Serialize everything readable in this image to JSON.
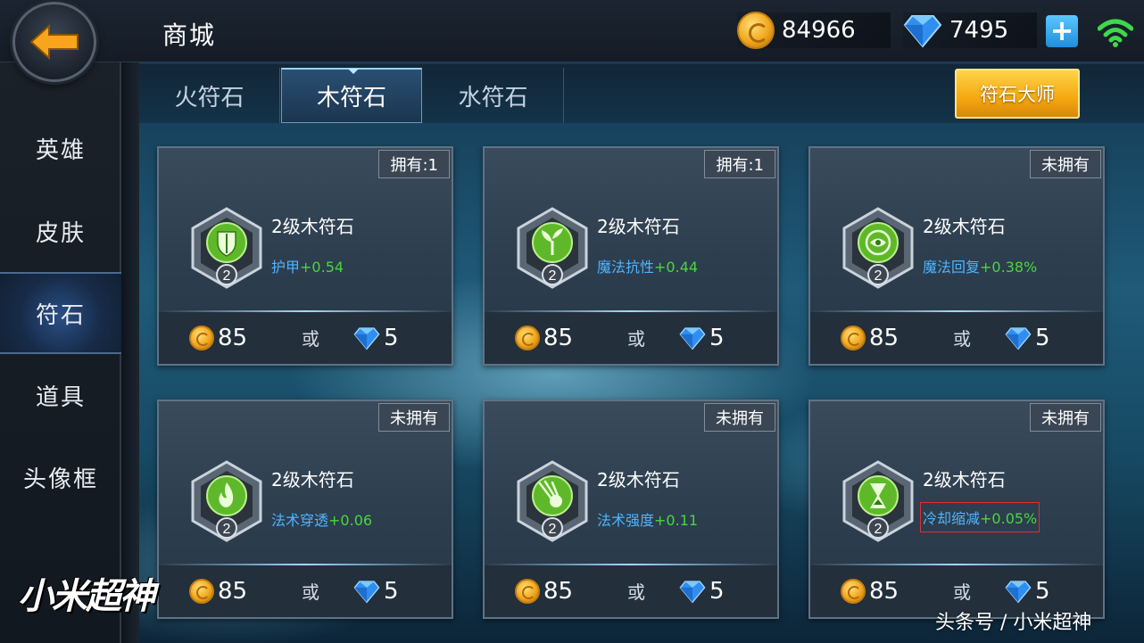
{
  "header": {
    "title": "商城",
    "gold": "84966",
    "gems": "7495"
  },
  "sidebar": {
    "items": [
      {
        "label": "英雄"
      },
      {
        "label": "皮肤"
      },
      {
        "label": "符石"
      },
      {
        "label": "道具"
      },
      {
        "label": "头像框"
      }
    ],
    "active": "符石"
  },
  "tabs": [
    {
      "label": "火符石"
    },
    {
      "label": "木符石"
    },
    {
      "label": "水符石"
    }
  ],
  "active_tab": "木符石",
  "master_button": "符石大师",
  "cards": [
    {
      "badge": "拥有:1",
      "level": "2",
      "name": "2级木符石",
      "stat_name": "护甲",
      "stat_value": "+0.54",
      "gold_price": "85",
      "or": "或",
      "gem_price": "5",
      "icon": "shield-icon"
    },
    {
      "badge": "拥有:1",
      "level": "2",
      "name": "2级木符石",
      "stat_name": "魔法抗性",
      "stat_value": "+0.44",
      "gold_price": "85",
      "or": "或",
      "gem_price": "5",
      "icon": "sprout-icon"
    },
    {
      "badge": "未拥有",
      "level": "2",
      "name": "2级木符石",
      "stat_name": "魔法回复",
      "stat_value": "+0.38%",
      "gold_price": "85",
      "or": "或",
      "gem_price": "5",
      "icon": "swirl-icon"
    },
    {
      "badge": "未拥有",
      "level": "2",
      "name": "2级木符石",
      "stat_name": "法术穿透",
      "stat_value": "+0.06",
      "gold_price": "85",
      "or": "或",
      "gem_price": "5",
      "icon": "flame-icon"
    },
    {
      "badge": "未拥有",
      "level": "2",
      "name": "2级木符石",
      "stat_name": "法术强度",
      "stat_value": "+0.11",
      "gold_price": "85",
      "or": "或",
      "gem_price": "5",
      "icon": "comet-icon"
    },
    {
      "badge": "未拥有",
      "level": "2",
      "name": "2级木符石",
      "stat_name": "冷却缩减",
      "stat_value": "+0.05%",
      "gold_price": "85",
      "or": "或",
      "gem_price": "5",
      "icon": "hourglass-icon"
    }
  ],
  "logo_text": "小米超神",
  "watermark": "头条号 / 小米超神",
  "colors": {
    "stat_name": "#4fb4ff",
    "stat_value": "#4ad63c",
    "master_button": "#f5a80f",
    "highlight_box": "#e03030"
  }
}
